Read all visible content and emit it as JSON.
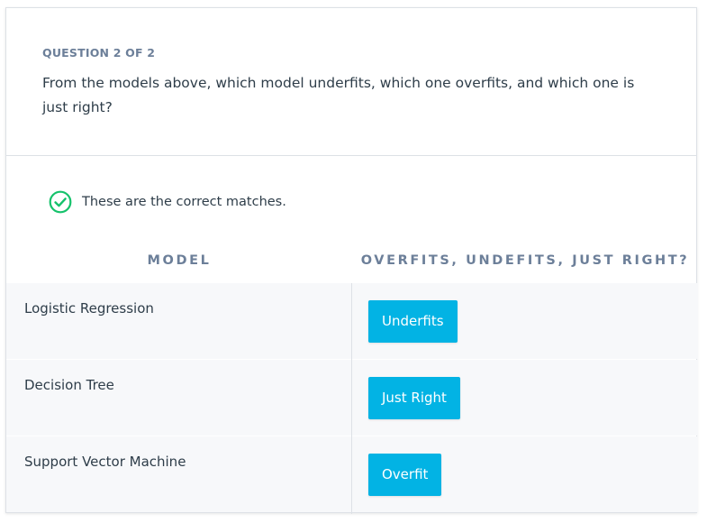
{
  "question": {
    "label": "QUESTION 2 OF 2",
    "text": "From the models above, which model underfits, which one overfits, and which one is just right?"
  },
  "feedback": {
    "icon": "check-circle-icon",
    "text": "These are the correct matches.",
    "color": "#15c26b"
  },
  "table": {
    "headers": {
      "model": "MODEL",
      "fit": "OVERFITS, UNDEFITS, JUST RIGHT?"
    },
    "rows": [
      {
        "model": "Logistic Regression",
        "answer": "Underfits"
      },
      {
        "model": "Decision Tree",
        "answer": "Just Right"
      },
      {
        "model": "Support Vector Machine",
        "answer": "Overfit"
      }
    ]
  },
  "colors": {
    "accent": "#02b3e4",
    "label": "#6c7f99",
    "text": "#2e3d49",
    "row_bg": "#f7f8fa",
    "border": "#dde1e6"
  }
}
